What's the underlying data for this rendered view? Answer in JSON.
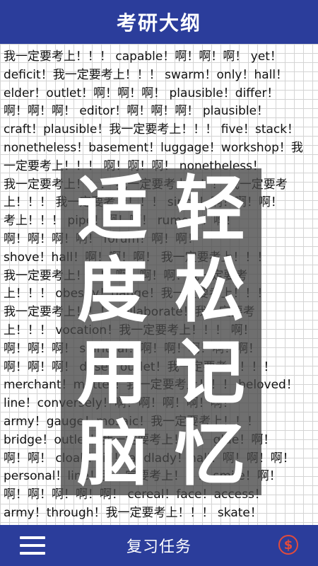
{
  "header": {
    "title": "考研大纲"
  },
  "content": {
    "lines": [
      "我一定要考上！！！ capable！啊！啊！啊！ yet！",
      "deficit！我一定要考上！！！ swarm！only！hall！",
      "elder！outlet！啊！啊！啊！ plausible！differ！",
      "啊！啊！啊！ editor！啊！啊！啊！ plausible！",
      "craft！plausible！我一定要考上！！！ five！stack！",
      "nonetheless！basement！luggage！workshop！我",
      "一定要考上！！！ 啊！啊！啊！ nonetheless！",
      "我一定要考上！！！ 我一定要考上！！！ 我一定要考",
      "上！！！ 我一定要考上！！！ since！啊！啊！啊！",
      "考上！！！ pipe！啊！啊！ rumour！啊！",
      "啊！啊！啊！啊！ forum！啊！啊！",
      "shove！hall！啊！啊！啊！ 我一定要考上！！！",
      "我一定要考上！！！ 啊！啊！啊！我一定要考",
      "上！！！ obesity！gauge！我一定要考上！！！",
      "我一定要考上！！！ collaborate！我一定要考",
      "上！！！ vocation！我一定要考上！！！ 啊！",
      "啊！啊！啊！ spiritual！啊！啊！啊！啊！啊！",
      "啊！啊！啊！ dose！outlet！我一定要考上！！！",
      "merchant！mutter！我一定要考上！！！ beloved！",
      "line！conversely！啊！啊！啊！啊！啊！",
      "army！gauge！mosaic！我一定要考上！！！",
      "bridge！outlet！我一定要考上！！！ glue！啊！",
      "啊！啊！ cloak！lid！landlady！hall！啊！啊！啊！",
      "personal！line！我一定要考上！！！ smile！啊！",
      "啊！啊！啊！啊！啊！ cereal！face！access！",
      "army！through！我一定要考上！！！ skate！"
    ]
  },
  "overlay": {
    "left_chars": [
      "适",
      "度",
      "用",
      "脑"
    ],
    "right_chars": [
      "轻",
      "松",
      "记",
      "忆"
    ]
  },
  "footer": {
    "menu_icon": "hamburger-menu-icon",
    "title": "复习任务",
    "coin_symbol": "$",
    "coin_color": "#e24b3b"
  },
  "colors": {
    "accent": "#2b3d9b"
  }
}
